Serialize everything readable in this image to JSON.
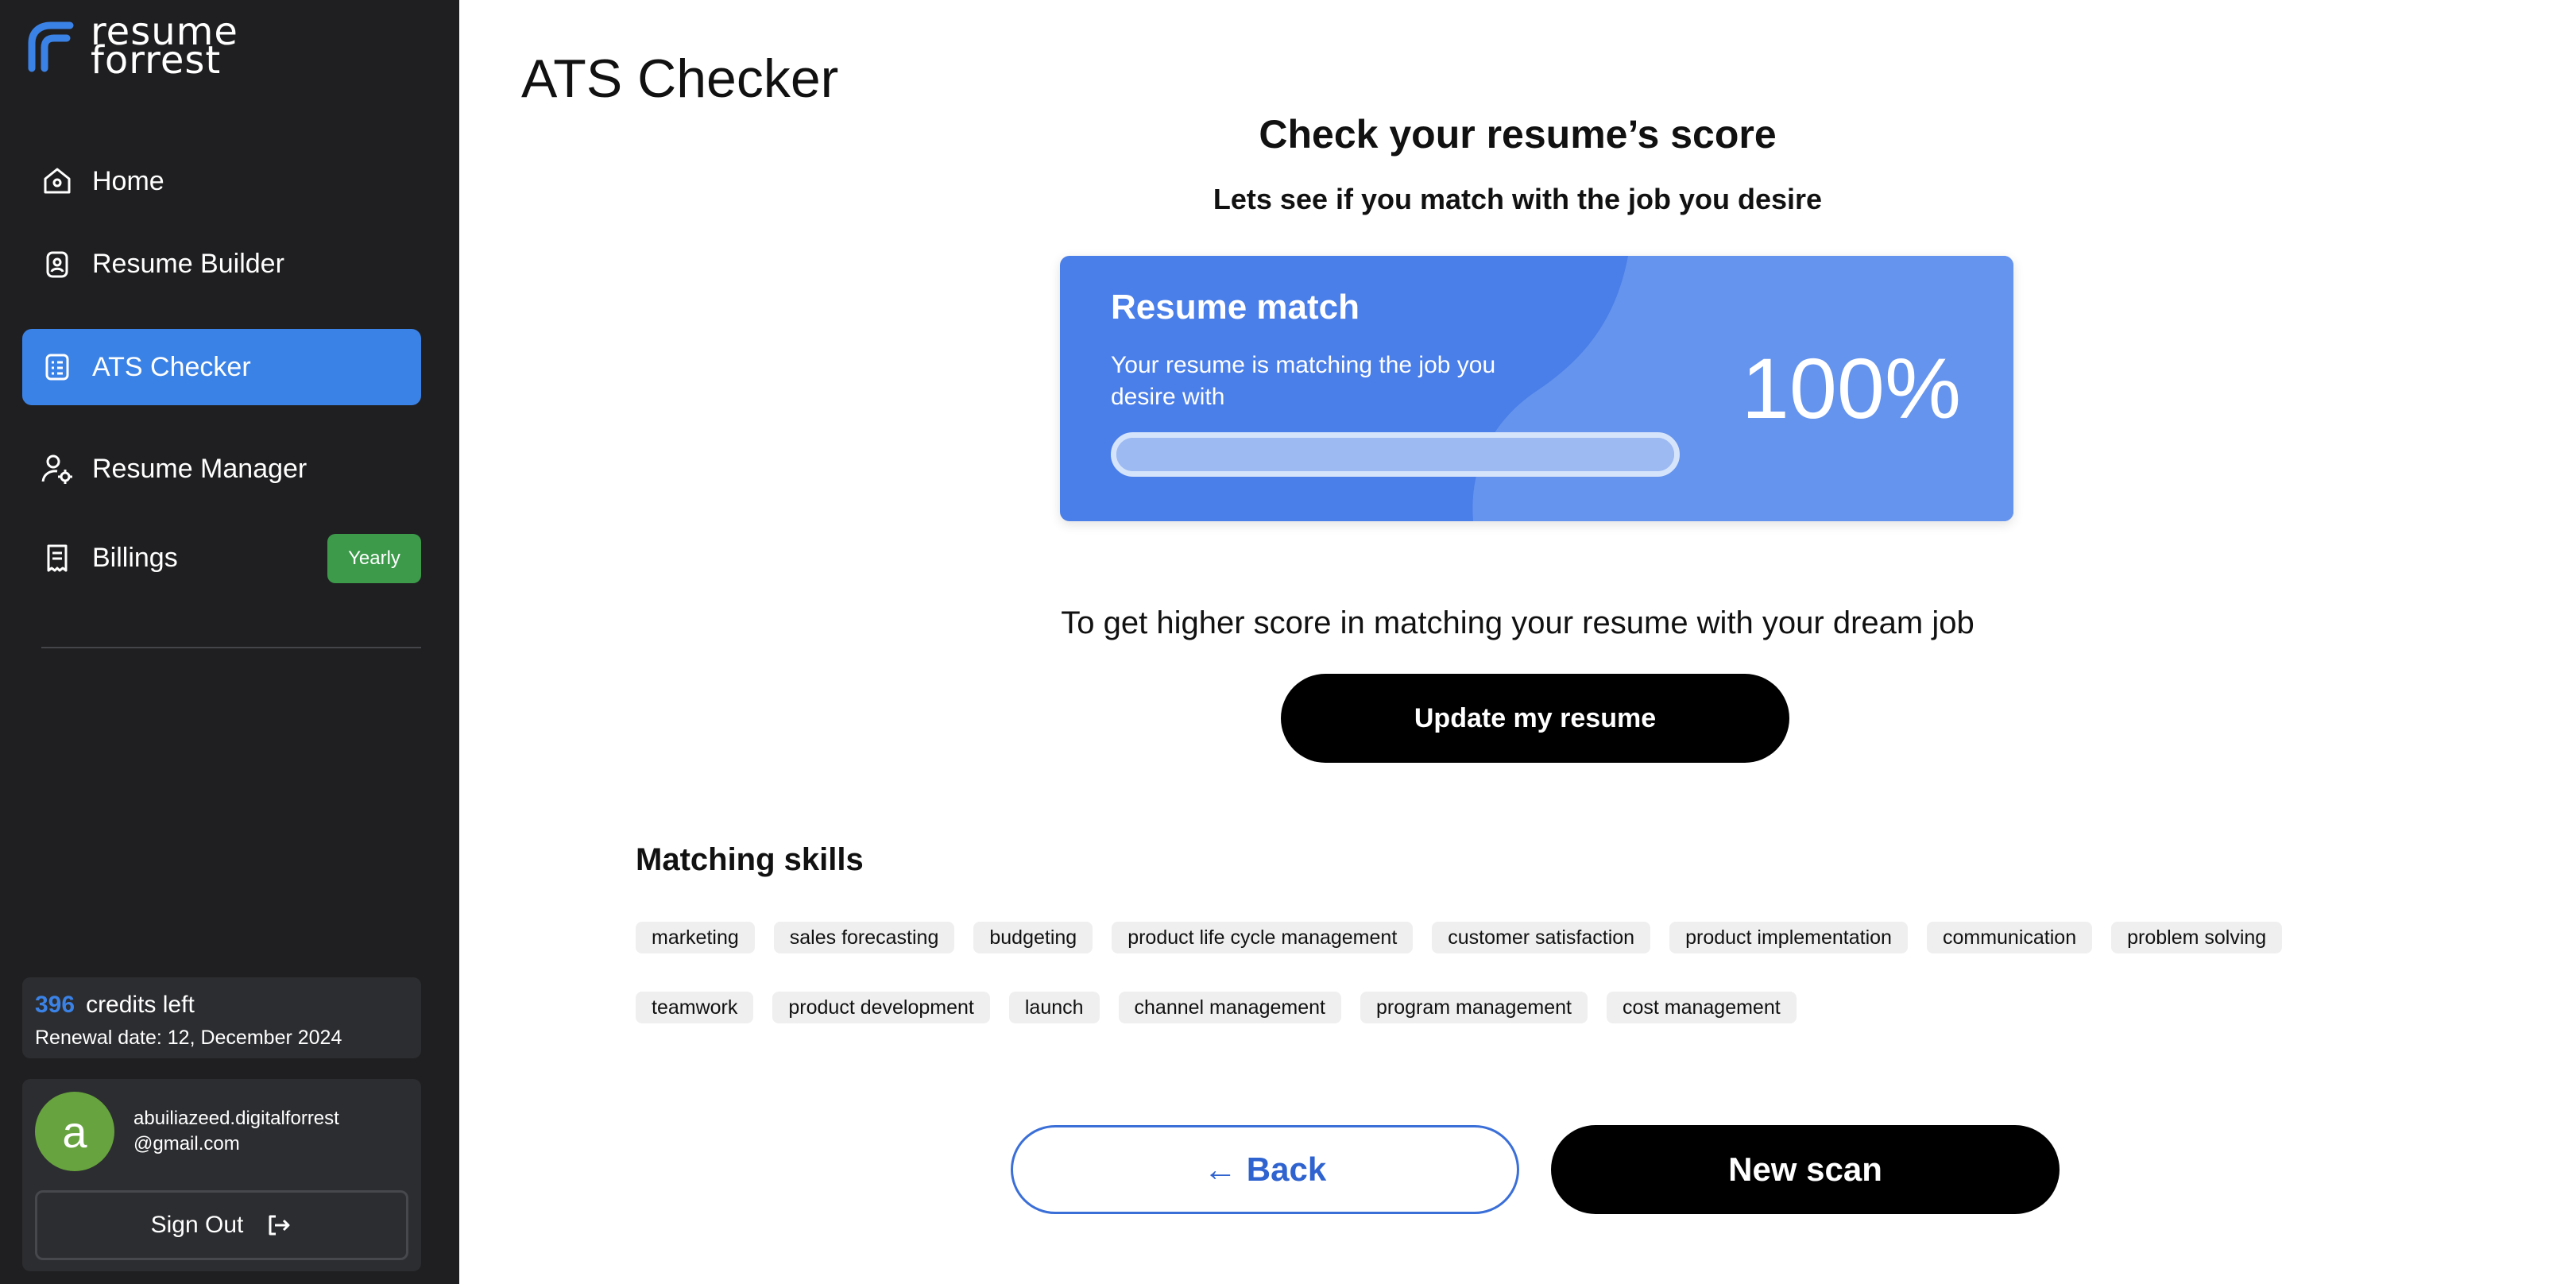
{
  "brand": {
    "line1": "resume",
    "line2": "forrest",
    "logo_icon": "logo-mark-icon"
  },
  "page_title": "ATS Checker",
  "sidebar": {
    "items": [
      {
        "label": "Home",
        "icon": "home-icon",
        "active": false
      },
      {
        "label": "Resume Builder",
        "icon": "badge-icon",
        "active": false
      },
      {
        "label": "ATS Checker",
        "icon": "checklist-icon",
        "active": true
      },
      {
        "label": "Resume Manager",
        "icon": "user-gear-icon",
        "active": false
      },
      {
        "label": "Billings",
        "icon": "receipt-icon",
        "active": false,
        "badge": "Yearly"
      }
    ],
    "credits": {
      "count": "396",
      "label": "credits left",
      "renewal": "Renewal date: 12, December 2024"
    },
    "user": {
      "avatar_letter": "a",
      "email_line1": "abuiliazeed.digitalforrest",
      "email_line2": "@gmail.com"
    },
    "signout_label": "Sign Out"
  },
  "main": {
    "heading": "Check your resume’s score",
    "subheading": "Lets see if you match with the job you desire",
    "match_card": {
      "title": "Resume match",
      "description": "Your resume is matching the job you desire with",
      "percent_text": "100%",
      "progress": 1.0
    },
    "tip": "To get higher score in matching your resume with your dream job",
    "update_button": "Update my resume",
    "skills_title": "Matching skills",
    "skills_row1": [
      "marketing",
      "sales forecasting",
      "budgeting",
      "product life cycle management",
      "customer satisfaction",
      "product implementation",
      "communication",
      "problem solving"
    ],
    "skills_row2": [
      "teamwork",
      "product development",
      "launch",
      "channel management",
      "program management",
      "cost management"
    ],
    "back_button": "Back",
    "new_scan_button": "New scan"
  },
  "colors": {
    "sidebar_bg": "#1f1f21",
    "accent": "#3b82e6",
    "card_blue": "#4a7ee8",
    "badge_green": "#3c9a4a",
    "avatar_green": "#67a33e"
  }
}
